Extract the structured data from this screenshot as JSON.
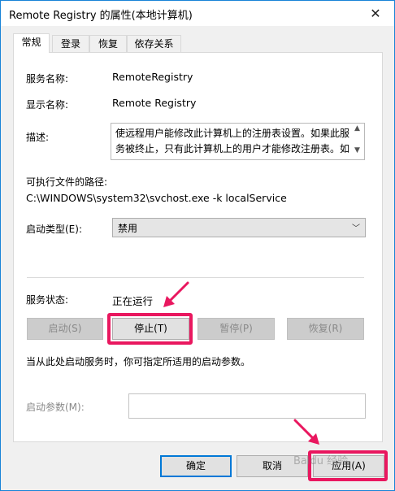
{
  "window": {
    "title": "Remote Registry 的属性(本地计算机)",
    "close": "✕"
  },
  "tabs": [
    "常规",
    "登录",
    "恢复",
    "依存关系"
  ],
  "general": {
    "service_name_label": "服务名称:",
    "service_name": "RemoteRegistry",
    "display_name_label": "显示名称:",
    "display_name": "Remote Registry",
    "description_label": "描述:",
    "description": "使远程用户能修改此计算机上的注册表设置。如果此服务被终止，只有此计算机上的用户才能修改注册表。如",
    "path_label": "可执行文件的路径:",
    "path": "C:\\WINDOWS\\system32\\svchost.exe -k localService",
    "startup_type_label": "启动类型(E):",
    "startup_type": "禁用",
    "status_label": "服务状态:",
    "status": "正在运行",
    "buttons": {
      "start": "启动(S)",
      "stop": "停止(T)",
      "pause": "暂停(P)",
      "resume": "恢复(R)"
    },
    "hint": "当从此处启动服务时，你可指定所适用的启动参数。",
    "params_label": "启动参数(M):",
    "params_value": ""
  },
  "footer": {
    "ok": "确定",
    "cancel": "取消",
    "apply": "应用(A)"
  },
  "watermark": "Baidu 经验",
  "colors": {
    "highlight": "#e9175f",
    "accent": "#0078d7"
  }
}
